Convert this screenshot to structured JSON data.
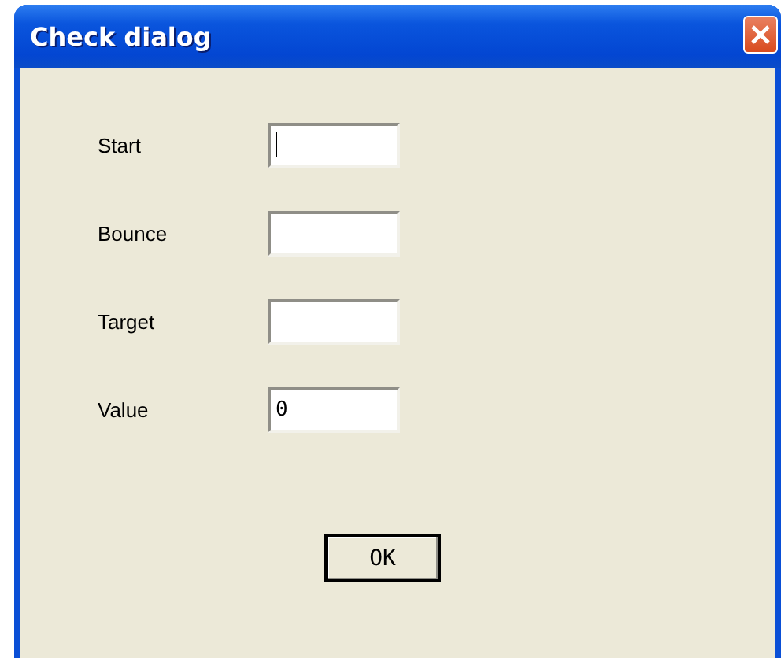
{
  "window": {
    "title": "Check dialog"
  },
  "fields": [
    {
      "label": "Start",
      "focused": true
    },
    {
      "label": "Bounce",
      "focused": false
    },
    {
      "label": "Target",
      "focused": false
    },
    {
      "label": "Value",
      "value": "0",
      "focused": false
    }
  ],
  "buttons": [
    "OK"
  ]
}
